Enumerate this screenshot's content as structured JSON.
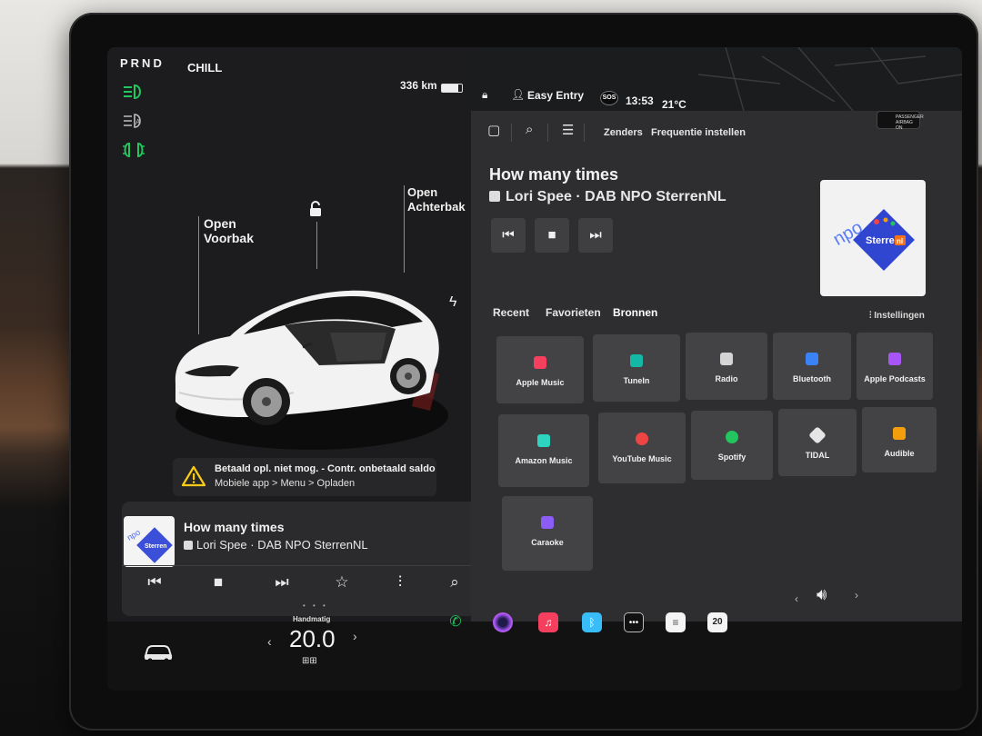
{
  "status": {
    "gear": "PRND",
    "drive_mode": "CHILL",
    "range": "336 km",
    "profile": "Easy Entry",
    "time": "13:53",
    "outside_temp": "21°C",
    "airbag": "PASSENGER AIRBAG ON",
    "sos": "SOS"
  },
  "car": {
    "frunk_label": "Open\nVoorbak",
    "trunk_label": "Open\nAchterbak"
  },
  "alert": {
    "title": "Betaald opl. niet mog. - Contr. onbetaald saldo",
    "subtitle": "Mobiele app > Menu > Opladen"
  },
  "media": {
    "title": "How many times",
    "subtitle": "Lori Spee · DAB NPO SterrenNL",
    "station_logo_text": "Sterren",
    "station_logo_badge": "nl",
    "npo_text": "npo",
    "toolbar_tabs": [
      "Zenders",
      "Frequentie instellen"
    ],
    "source_tabs": [
      "Recent",
      "Favorieten",
      "Bronnen"
    ],
    "settings_label": "Instellingen",
    "sources": [
      {
        "label": "Apple Music",
        "color": "#f43f5e"
      },
      {
        "label": "TuneIn",
        "color": "#14b8a6"
      },
      {
        "label": "Radio",
        "color": "#d4d4d4"
      },
      {
        "label": "Bluetooth",
        "color": "#3b82f6"
      },
      {
        "label": "Apple Podcasts",
        "color": "#a855f7"
      },
      {
        "label": "Amazon Music",
        "color": "#2dd4bf"
      },
      {
        "label": "YouTube Music",
        "color": "#ef4444"
      },
      {
        "label": "Spotify",
        "color": "#22c55e"
      },
      {
        "label": "TIDAL",
        "color": "#e5e5e5"
      },
      {
        "label": "Audible",
        "color": "#f59e0b"
      },
      {
        "label": "Caraoke",
        "color": "#8b5cf6"
      }
    ]
  },
  "climate": {
    "mode": "Handmatig",
    "temperature": "20.0"
  },
  "dock": {
    "calendar_day": "20",
    "apps": [
      "phone",
      "camera",
      "apple-music",
      "bluetooth",
      "more",
      "notes",
      "calendar"
    ]
  }
}
